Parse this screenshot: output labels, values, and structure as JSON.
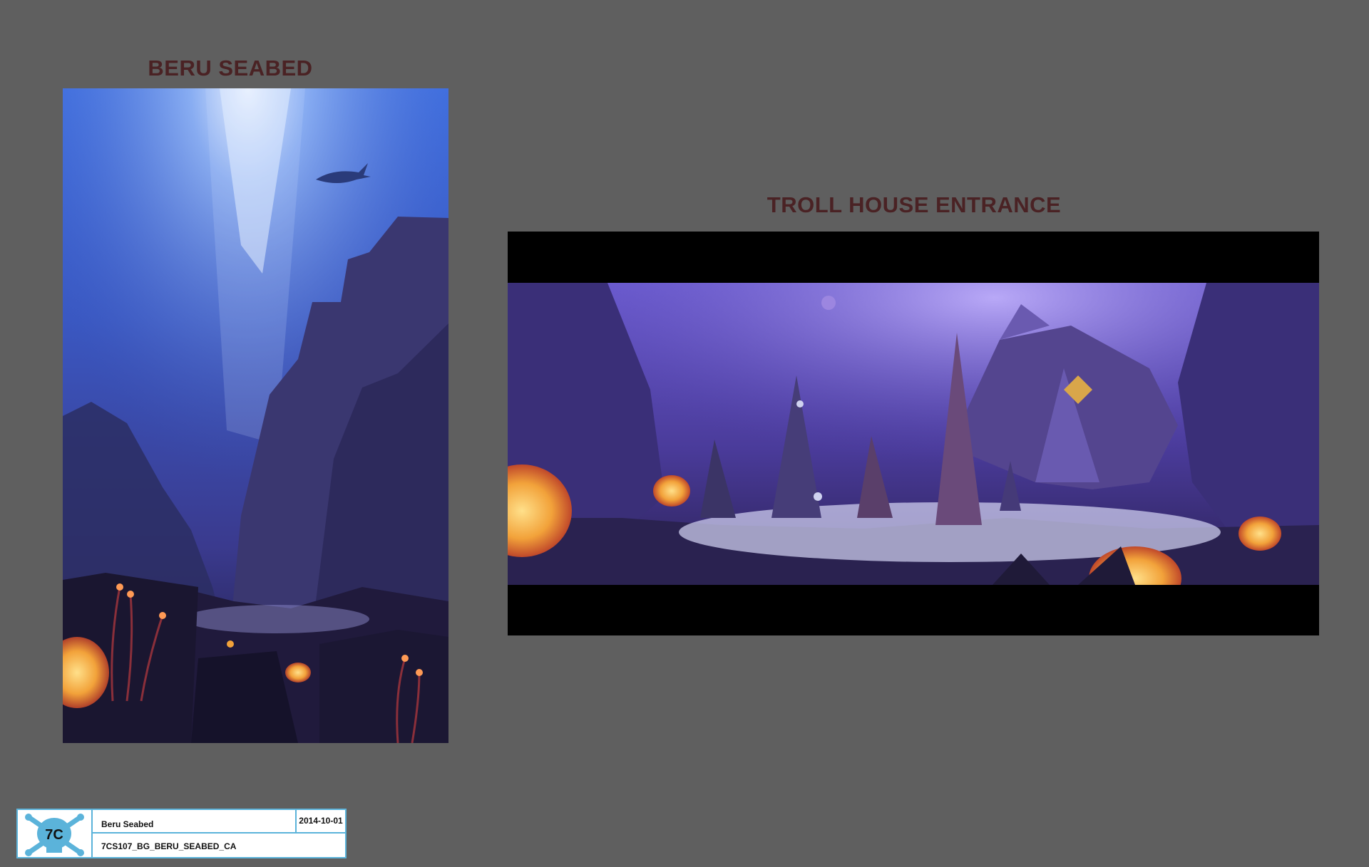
{
  "left_panel": {
    "title": "BERU SEABED"
  },
  "right_panel": {
    "title": "TROLL HOUSE ENTRANCE"
  },
  "title_block": {
    "name": "Beru Seabed",
    "date": "2014-10-01",
    "code": "7CS107_BG_BERU_SEABED_CA",
    "logo_text": "7C"
  },
  "colors": {
    "background": "#5f5f5f",
    "title": "#4a2224",
    "frame_border": "#5bb3da",
    "coral_glow": "#f2a23a"
  }
}
